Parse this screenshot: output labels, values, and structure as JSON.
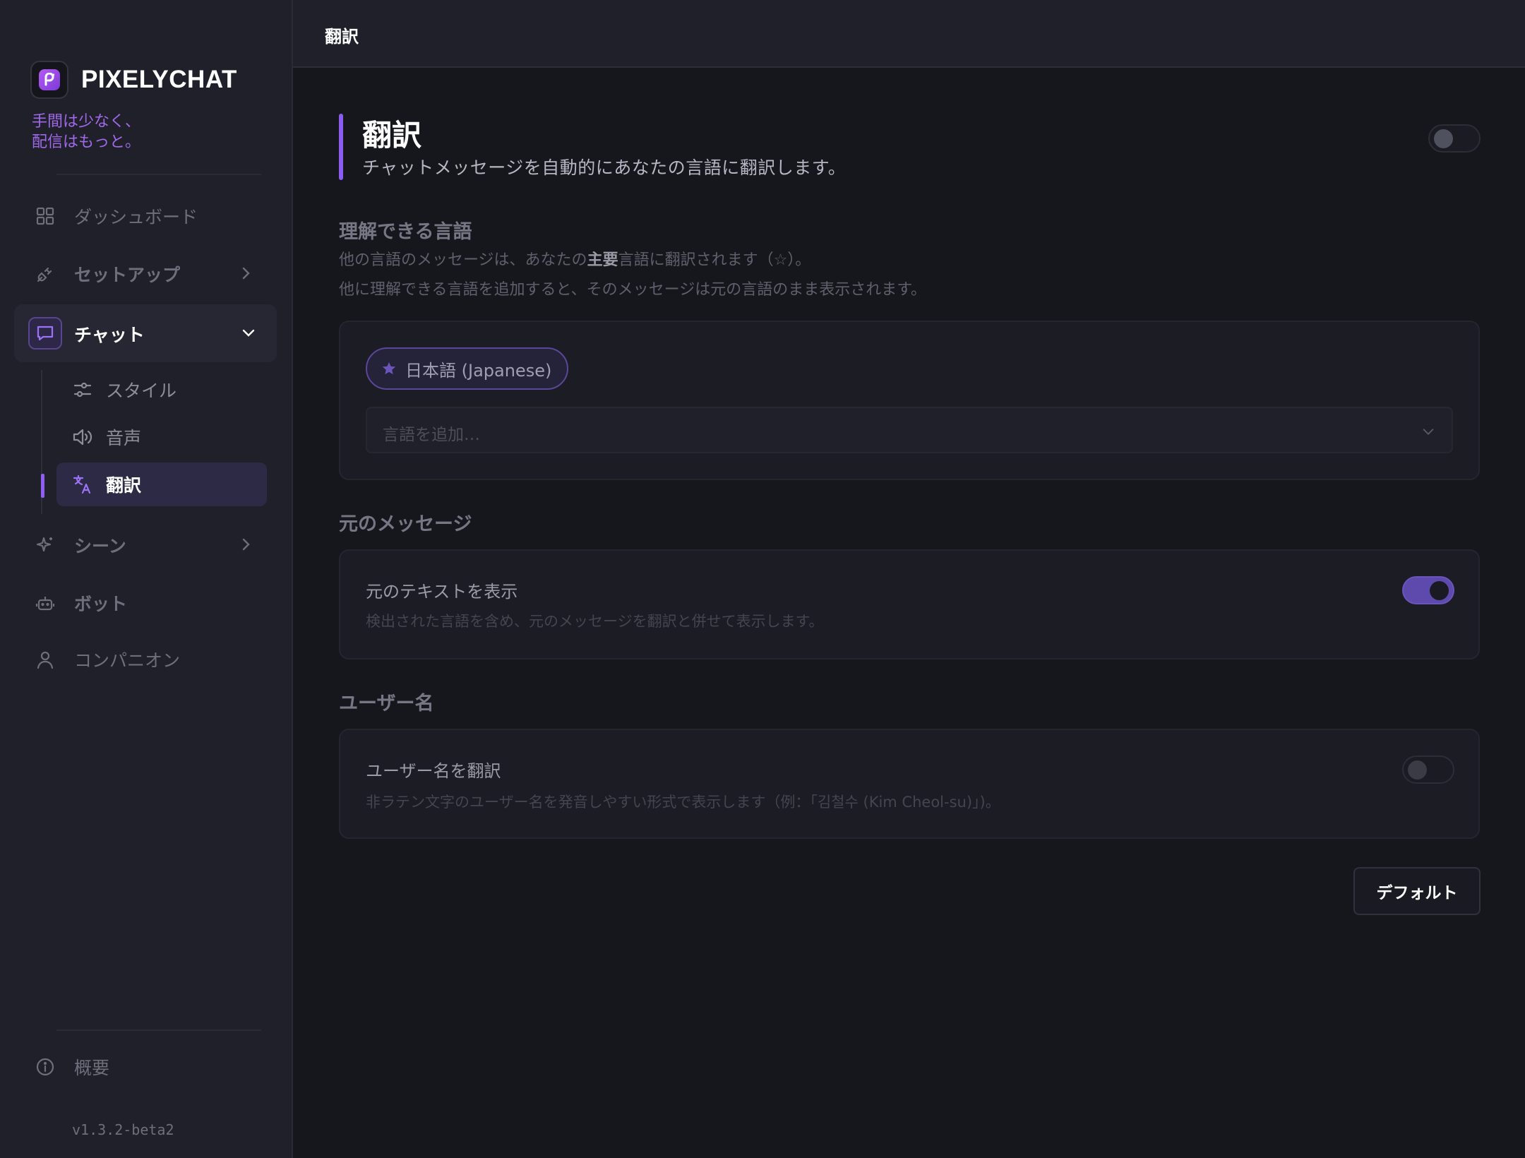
{
  "app": {
    "name": "PIXELYCHAT",
    "tagline_line1": "手間は少なく、",
    "tagline_line2": "配信はもっと。",
    "version": "v1.3.2-beta2"
  },
  "sidebar": {
    "dashboard": "ダッシュボード",
    "setup": "セットアップ",
    "chat": "チャット",
    "chat_sub": {
      "style": "スタイル",
      "voice": "音声",
      "translation": "翻訳"
    },
    "scene": "シーン",
    "bot": "ボット",
    "companion": "コンパニオン",
    "about": "概要"
  },
  "header": {
    "title": "翻訳"
  },
  "section": {
    "title": "翻訳",
    "description": "チャットメッセージを自動的にあなたの言語に翻訳します。",
    "enabled": false
  },
  "languages": {
    "title": "理解できる言語",
    "desc_line1_pre": "他の言語のメッセージは、あなたの",
    "desc_line1_bold": "主要",
    "desc_line1_post": "言語に翻訳されます（☆）。",
    "desc_line2": "他に理解できる言語を追加すると、そのメッセージは元の言語のまま表示されます。",
    "chip_label": "日本語 (Japanese)",
    "add_placeholder": "言語を追加…"
  },
  "original": {
    "title": "元のメッセージ",
    "option_title": "元のテキストを表示",
    "option_desc": "検出された言語を含め、元のメッセージを翻訳と併せて表示します。",
    "enabled": true
  },
  "username": {
    "title": "ユーザー名",
    "option_title": "ユーザー名を翻訳",
    "option_desc": "非ラテン文字のユーザー名を発音しやすい形式で表示します（例：「김철수 (Kim Cheol-su)」)。",
    "enabled": false
  },
  "buttons": {
    "default": "デフォルト"
  },
  "colors": {
    "accent": "#8a5cf0",
    "toggle_on": "#5e49ad"
  }
}
